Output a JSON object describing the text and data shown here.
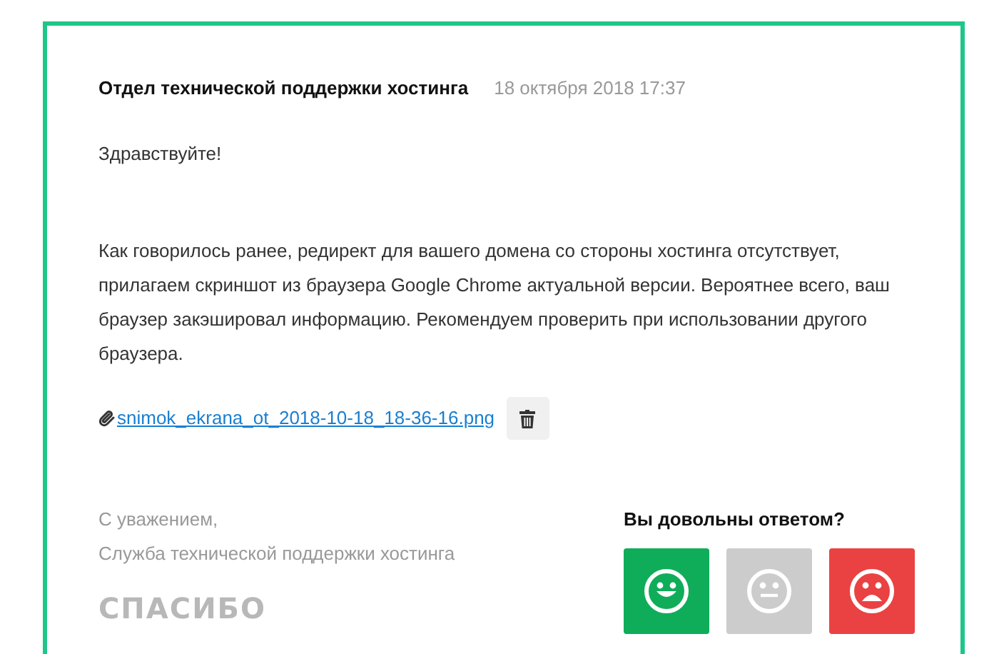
{
  "message": {
    "sender": "Отдел технической поддержки хостинга",
    "date": "18 октября 2018 17:37",
    "greeting": "Здравствуйте!",
    "body": "Как говорилось ранее, редирект для вашего домена со стороны хостинга отсутствует, прилагаем скриншот из браузера Google Chrome актуальной версии. Вероятнее всего, ваш браузер закэшировал информацию. Рекомендуем проверить при использовании другого браузера.",
    "attachment": {
      "filename": "snimok_ekrana_ot_2018-10-18_18-36-16.png"
    },
    "signature": [
      "С уважением,",
      "Служба технической поддержки хостинга"
    ],
    "thanks_label": "СПАСИБО"
  },
  "rating": {
    "question": "Вы довольны ответом?",
    "options": [
      {
        "kind": "happy",
        "color": "#0fad5a"
      },
      {
        "kind": "neutral",
        "color": "#cccccc"
      },
      {
        "kind": "sad",
        "color": "#ea4242"
      }
    ]
  }
}
